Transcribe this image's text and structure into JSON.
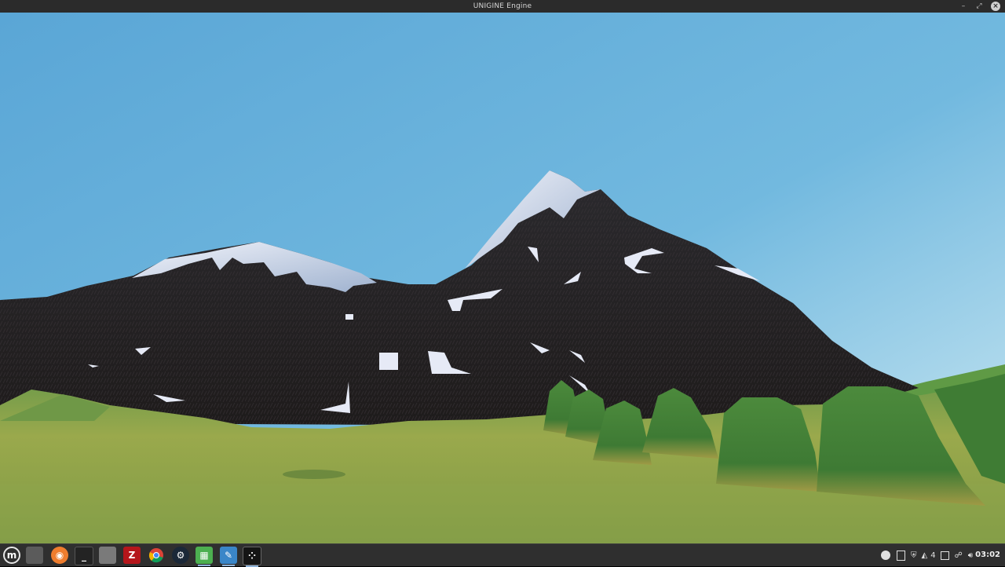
{
  "window": {
    "title": "UNIGINE Engine",
    "controls": {
      "minimize": "–",
      "maximize": "⤢",
      "close": "×"
    }
  },
  "scene": {
    "description_icons": [
      "sky",
      "mountain-left",
      "mountain-peak",
      "grass-plain",
      "green-mounds"
    ],
    "colors": {
      "sky_top": "#5aa6d6",
      "sky_bottom": "#bfe3f1",
      "rock": "#2a2a2a",
      "snow": "#e8eef7",
      "grass": "#8aa34a",
      "mound": "#4f8a3a"
    }
  },
  "taskbar": {
    "apps": [
      {
        "name": "menu",
        "glyph": "m",
        "bg": "#2f2f2f"
      },
      {
        "name": "files-desktop",
        "glyph": "",
        "bg": "#5b5b5b"
      },
      {
        "name": "firefox",
        "glyph": "◉",
        "bg": "#ef7d2e"
      },
      {
        "name": "terminal",
        "glyph": "_",
        "bg": "#232323"
      },
      {
        "name": "folder",
        "glyph": "",
        "bg": "#7a7a7a"
      },
      {
        "name": "filezilla",
        "glyph": "Z",
        "bg": "#b5161b"
      },
      {
        "name": "chrome",
        "glyph": "●",
        "bg": "#2f2f2f"
      },
      {
        "name": "steam",
        "glyph": "⚙",
        "bg": "#1b2838"
      },
      {
        "name": "green-app",
        "glyph": "▦",
        "bg": "#4caf50"
      },
      {
        "name": "editor",
        "glyph": "✎",
        "bg": "#3a86c8"
      },
      {
        "name": "unigine",
        "glyph": "⁘",
        "bg": "#151515"
      }
    ],
    "tray": {
      "workspace_count": "4",
      "time": "03:02"
    }
  }
}
